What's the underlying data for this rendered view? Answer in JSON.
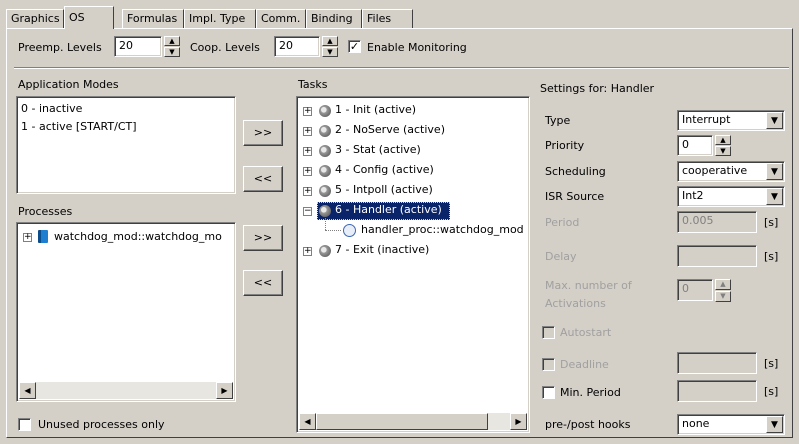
{
  "tabs": [
    "Graphics",
    "OS",
    "Formulas",
    "Impl. Type",
    "Comm.",
    "Binding",
    "Files"
  ],
  "active_tab": "OS",
  "top": {
    "preemp_label": "Preemp. Levels",
    "preemp_value": "20",
    "coop_label": "Coop. Levels",
    "coop_value": "20",
    "monitoring_label": "Enable Monitoring",
    "monitoring_checked": true
  },
  "app_modes": {
    "label": "Application Modes",
    "items": [
      "0 - inactive",
      "1 - active [START/CT]"
    ]
  },
  "buttons": {
    "add": ">>",
    "remove": "<<"
  },
  "processes": {
    "label": "Processes",
    "items": [
      "watchdog_mod::watchdog_mo"
    ],
    "unused_only_label": "Unused processes only"
  },
  "tasks": {
    "label": "Tasks",
    "items": [
      "1 - Init (active)",
      "2 - NoServe (active)",
      "3 - Stat (active)",
      "4 - Config (active)",
      "5 - Intpoll (active)",
      "6 - Handler (active)",
      "handler_proc::watchdog_mod",
      "7 - Exit (inactive)"
    ],
    "selected": "6 - Handler (active)"
  },
  "settings": {
    "title": "Settings for: Handler",
    "type_label": "Type",
    "type_value": "Interrupt",
    "priority_label": "Priority",
    "priority_value": "0",
    "scheduling_label": "Scheduling",
    "scheduling_value": "cooperative",
    "isr_label": "ISR Source",
    "isr_value": "Int2",
    "period_label": "Period",
    "period_value": "0.005",
    "delay_label": "Delay",
    "delay_value": "",
    "max_act_label_1": "Max. number of",
    "max_act_label_2": "Activations",
    "max_act_value": "0",
    "autostart_label": "Autostart",
    "deadline_label": "Deadline",
    "min_period_label": "Min. Period",
    "hooks_label": "pre-/post hooks",
    "hooks_value": "none",
    "unit": "[s]"
  },
  "icons": {
    "checkmark": "check-icon",
    "dropdown": "chevron-down-icon",
    "gear": "gear-icon",
    "process": "process-book-icon"
  },
  "colors": {
    "face": "#d4d0c8",
    "selection": "#0a246a",
    "disabled_text": "#a0a0a0"
  }
}
